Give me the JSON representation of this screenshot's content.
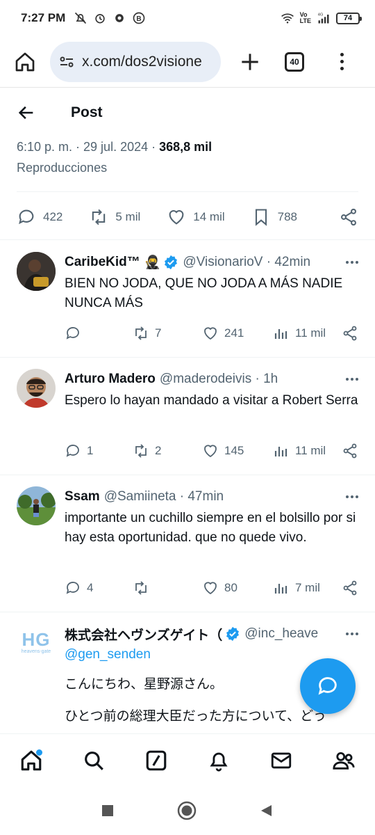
{
  "status_bar": {
    "time": "7:27 PM",
    "lte_top": "Vo",
    "lte_bottom": "LTE",
    "network": "4G",
    "battery": "74"
  },
  "browser": {
    "url": "x.com/dos2visione",
    "tab_count": "40"
  },
  "header": {
    "title": "Post"
  },
  "post_meta": {
    "time_date": "6:10 p. m. · 29 jul. 2024 · ",
    "views_count": "368,8 mil",
    "views_label": "Reproducciones"
  },
  "post_actions": {
    "replies": "422",
    "reposts": "5 mil",
    "likes": "14 mil",
    "bookmarks": "788"
  },
  "replies": [
    {
      "name": "CaribeKid™",
      "emoji": "🥷",
      "verified": true,
      "handle": "@VisionarioV · 42min",
      "text": "BIEN NO JODA, QUE NO JODA A MÁS NADIE NUNCA MÁS",
      "replies": "",
      "reposts": "7",
      "likes": "241",
      "views": "11 mil"
    },
    {
      "name": "Arturo Madero",
      "handle": "@maderodeivis · 1h",
      "text": "Espero lo hayan mandado a visitar a Robert Serra",
      "replies": "1",
      "reposts": "2",
      "likes": "145",
      "views": "11 mil"
    },
    {
      "name": "Ssam",
      "handle": "@Samiineta · 47min",
      "text": "importante un cuchillo siempre en el bolsillo por si hay esta oportunidad. que no quede vivo.",
      "replies": "4",
      "reposts": "",
      "likes": "80",
      "views": "7 mil"
    },
    {
      "name": "株式会社ヘヴンズゲイト（",
      "verified": true,
      "handle": "@inc_heave",
      "mention": "@gen_senden",
      "text1": "こんにちわ、星野源さん。",
      "text2": "ひとつ前の総理大臣だった方について、どう",
      "avatar_text": "HG",
      "avatar_sub": "heavens-gate"
    }
  ],
  "colors": {
    "accent": "#1d9bf0",
    "text": "#0f1419",
    "muted": "#536471"
  }
}
